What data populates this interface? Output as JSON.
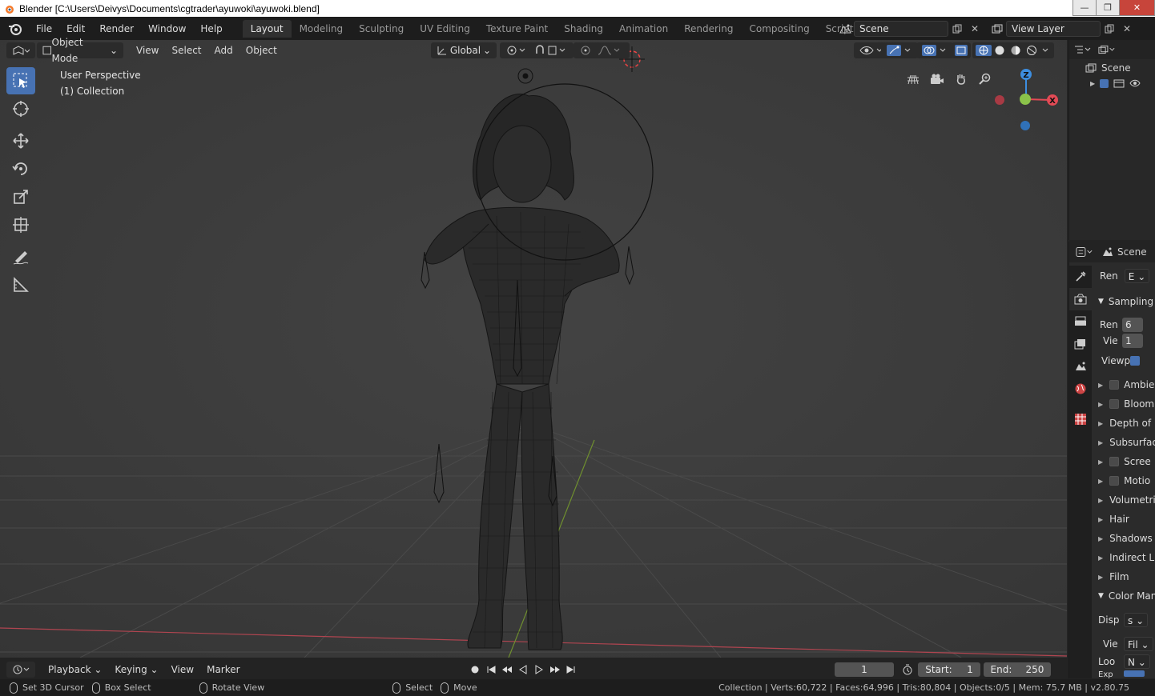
{
  "window": {
    "title": "Blender [C:\\Users\\Deivys\\Documents\\cgtrader\\ayuwoki\\ayuwoki.blend]",
    "minimize": "—",
    "maximize": "❐",
    "close": "✕"
  },
  "topbar": {
    "menu": [
      "File",
      "Edit",
      "Render",
      "Window",
      "Help"
    ],
    "workspaces": [
      "Layout",
      "Modeling",
      "Sculpting",
      "UV Editing",
      "Texture Paint",
      "Shading",
      "Animation",
      "Rendering",
      "Compositing",
      "Scripting"
    ],
    "active_workspace": "Layout",
    "add_workspace": "+",
    "scene": "Scene",
    "view_layer": "View Layer"
  },
  "viewport_header": {
    "mode": "Object Mode",
    "menus": [
      "View",
      "Select",
      "Add",
      "Object"
    ],
    "transform_orientation": "Global"
  },
  "viewport": {
    "perspective_label": "User Perspective",
    "collection_label": "(1) Collection",
    "gizmo": {
      "z": "Z",
      "x": "X"
    }
  },
  "outliner": {
    "root": "Scene"
  },
  "properties": {
    "header": "Scene",
    "render_engine_label": "Ren",
    "render_engine_value": "E",
    "sampling": "Sampling",
    "render_samples_label": "Ren",
    "render_samples_value": "6",
    "viewport_samples_label": "Vie",
    "viewport_samples_value": "1",
    "viewport_denoise_label": "Viewp",
    "panels": [
      {
        "label": "Ambie",
        "checkbox": true
      },
      {
        "label": "Bloom",
        "checkbox": true
      },
      {
        "label": "Depth of",
        "checkbox": false
      },
      {
        "label": "Subsurfac",
        "checkbox": false
      },
      {
        "label": "Scree",
        "checkbox": true
      },
      {
        "label": "Motio",
        "checkbox": true
      },
      {
        "label": "Volumetri",
        "checkbox": false
      },
      {
        "label": "Hair",
        "checkbox": false
      },
      {
        "label": "Shadows",
        "checkbox": false
      },
      {
        "label": "Indirect Li",
        "checkbox": false
      },
      {
        "label": "Film",
        "checkbox": false
      }
    ],
    "color_management": "Color Man",
    "display_label": "Disp",
    "display_value": "s",
    "view_label": "Vie",
    "view_value": "Fil",
    "look_label": "Loo",
    "look_value": "N",
    "exposure_label": "Exp"
  },
  "timeline": {
    "menus": [
      "Playback",
      "Keying",
      "View",
      "Marker"
    ],
    "current_frame": "1",
    "start_label": "Start:",
    "start_value": "1",
    "end_label": "End:",
    "end_value": "250"
  },
  "statusbar": {
    "set_cursor": "Set 3D Cursor",
    "box_select": "Box Select",
    "rotate_view": "Rotate View",
    "select": "Select",
    "move": "Move",
    "stats": "Collection | Verts:60,722 | Faces:64,996 | Tris:80,804 | Objects:0/5 | Mem: 75.7 MB | v2.80.75"
  },
  "colors": {
    "accent": "#4772b3",
    "axis_x": "#e34a55",
    "axis_y": "#8bc34a",
    "axis_z": "#3d8ee0"
  }
}
